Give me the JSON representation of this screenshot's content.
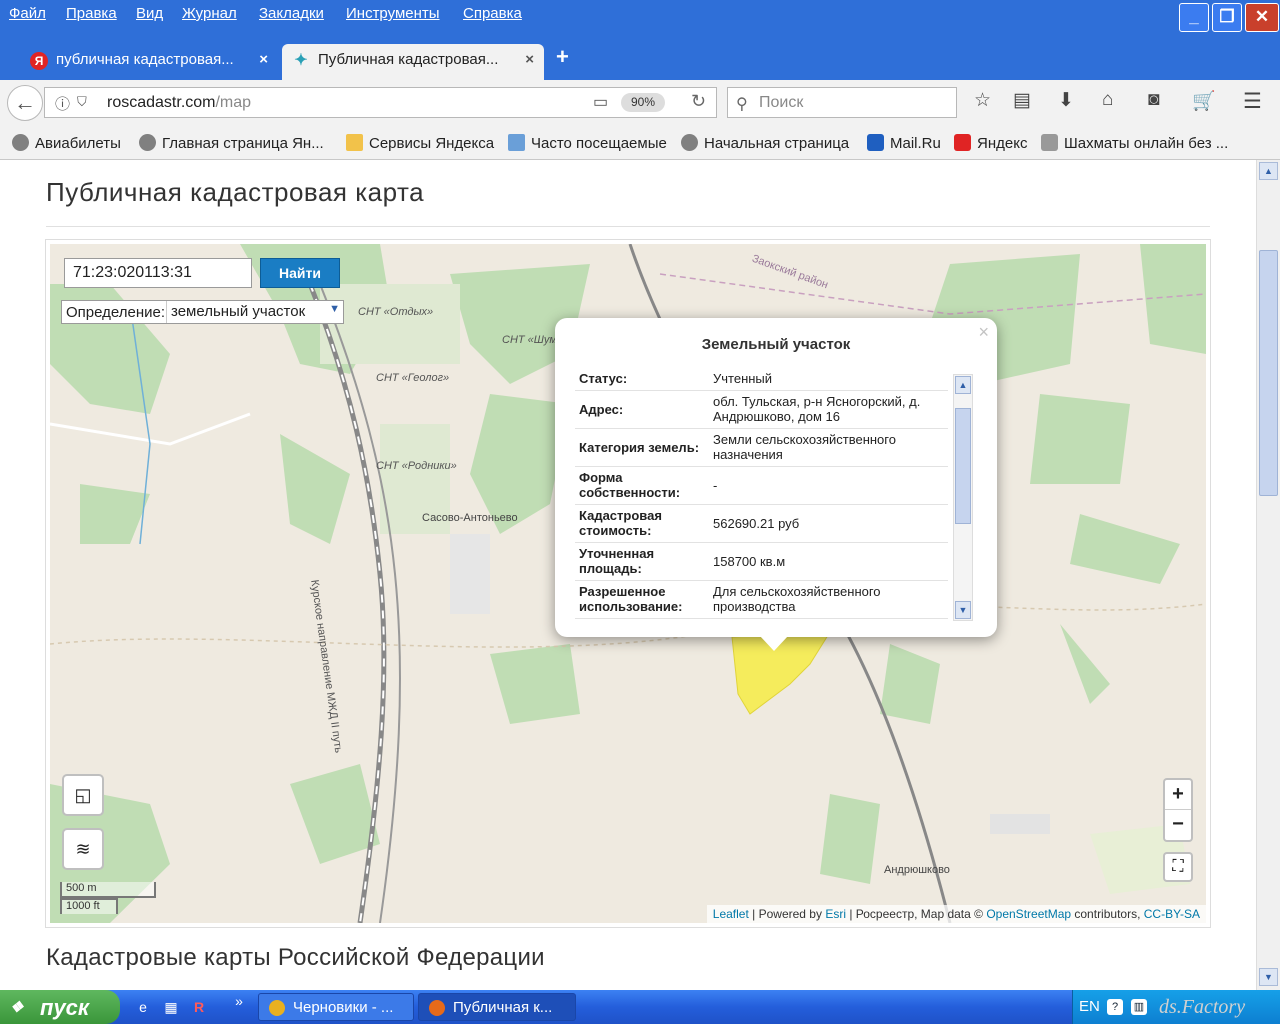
{
  "menu": [
    "Файл",
    "Правка",
    "Вид",
    "Журнал",
    "Закладки",
    "Инструменты",
    "Справка"
  ],
  "window_buttons": {
    "minimize": "_",
    "restore": "❐",
    "close": "✕"
  },
  "tabs": [
    {
      "title": "публичная кадастровая...",
      "favicon": "Я",
      "active": false
    },
    {
      "title": "Публичная кадастровая...",
      "favicon": "✦",
      "active": true
    }
  ],
  "new_tab": "+",
  "nav": {
    "url_domain": "roscadastr.com",
    "url_path": "/map",
    "zoom": "90%",
    "search_placeholder": "Поиск"
  },
  "bookmarks": [
    "Авиабилеты",
    "Главная страница Ян...",
    "Сервисы Яндекса",
    "Часто посещаемые",
    "Начальная страница",
    "Mail.Ru",
    "Яндекс",
    "Шахматы онлайн без ..."
  ],
  "page": {
    "title": "Публичная кадастровая карта",
    "section_title": "Кадастровые карты Российской Федерации"
  },
  "map": {
    "search_value": "71:23:020113:31",
    "search_button": "Найти",
    "definition_label": "Определение:",
    "definition_value": "земельный участок",
    "labels": [
      "СНТ «Отдых»",
      "СНТ «Шум»",
      "СНТ «Геолог»",
      "СНТ «Родники»",
      "Сасово-Антоньево",
      "Курское направление МЖД II путь",
      "Заокский район",
      "Андрюшково"
    ],
    "scale_metric": "500 m",
    "scale_imperial": "1000 ft",
    "zoom_in": "+",
    "zoom_out": "−",
    "attribution": {
      "leaflet": "Leaflet",
      "powered": " | Powered by ",
      "esri": "Esri",
      "rosreestr": " | Росреестр, Map data © ",
      "osm": "OpenStreetMap",
      "contrib": " contributors, ",
      "license": "CC-BY-SA"
    }
  },
  "popup": {
    "title": "Земельный участок",
    "close": "×",
    "rows": [
      {
        "key": "Статус",
        "value": "Учтенный"
      },
      {
        "key": "Адрес",
        "value": "обл. Тульская, р-н Ясногорский, д. Андрюшково, дом 16"
      },
      {
        "key": "Категория земель",
        "value": "Земли сельскохозяйственного назначения"
      },
      {
        "key": "Форма собственности",
        "value": "-"
      },
      {
        "key": "Кадастровая стоимость",
        "value": "562690.21 руб"
      },
      {
        "key": "Уточненная площадь",
        "value": "158700 кв.м"
      },
      {
        "key": "Разрешенное использование",
        "value": "Для сельскохозяйственного производства"
      }
    ]
  },
  "taskbar": {
    "start": "пуск",
    "tasks": [
      "Черновики - ...",
      "Публичная к..."
    ],
    "lang": "EN",
    "watermark": "ds.Factory"
  },
  "colors": {
    "accent": "#2f6fd8",
    "button": "#1a7dc4",
    "parcel": "#f5ec5c",
    "forest": "#c0ddb4"
  }
}
